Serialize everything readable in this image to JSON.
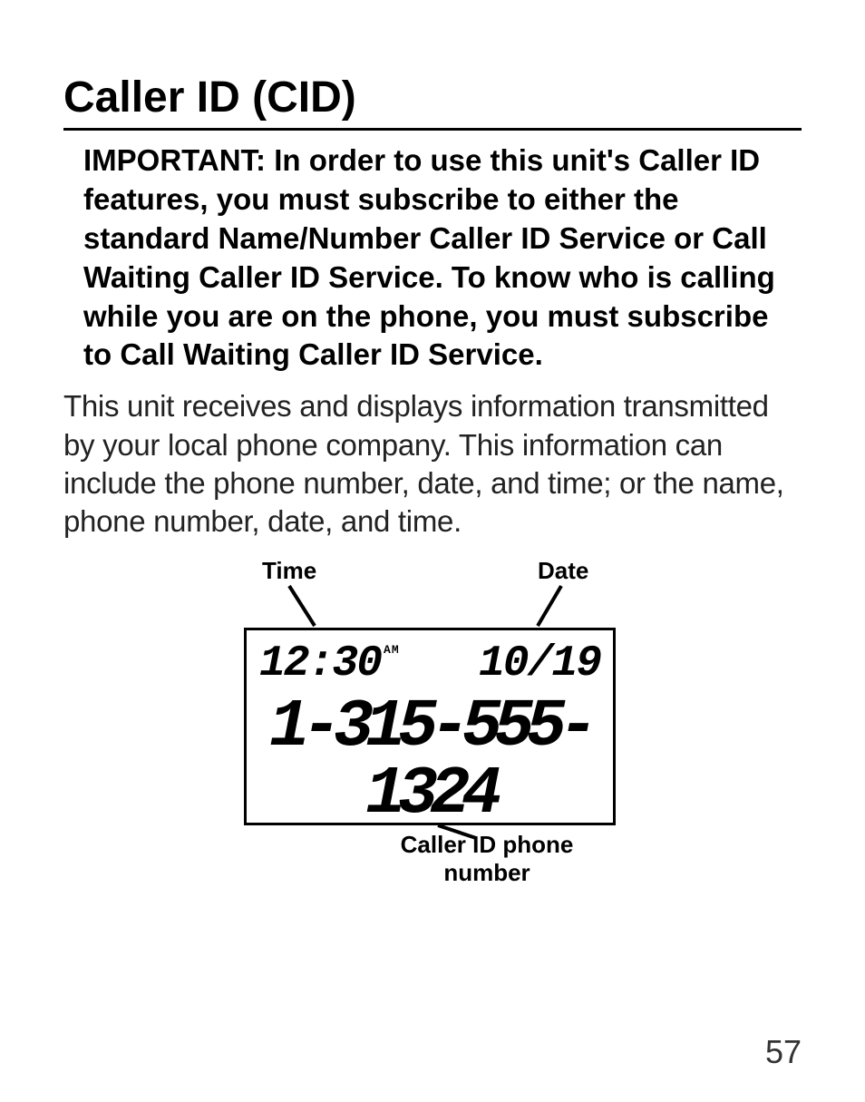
{
  "title": "Caller ID (CID)",
  "important": "IMPORTANT: In order to use this unit's Caller ID features, you must subscribe to either the standard Name/Number Caller ID Service or Call Waiting Caller ID Service. To know who is calling while you are on the phone, you must subscribe to Call Waiting Caller ID Service.",
  "body": "This unit receives and displays information transmitted by your local phone company. This information can include the phone number, date, and time; or the name, phone number, date, and time.",
  "diagram": {
    "label_time": "Time",
    "label_date": "Date",
    "label_number": "Caller ID phone number",
    "lcd": {
      "time": "12:30",
      "ampm": "AM",
      "date": "10/19",
      "number": "1-315-555-1324"
    }
  },
  "page_number": "57"
}
